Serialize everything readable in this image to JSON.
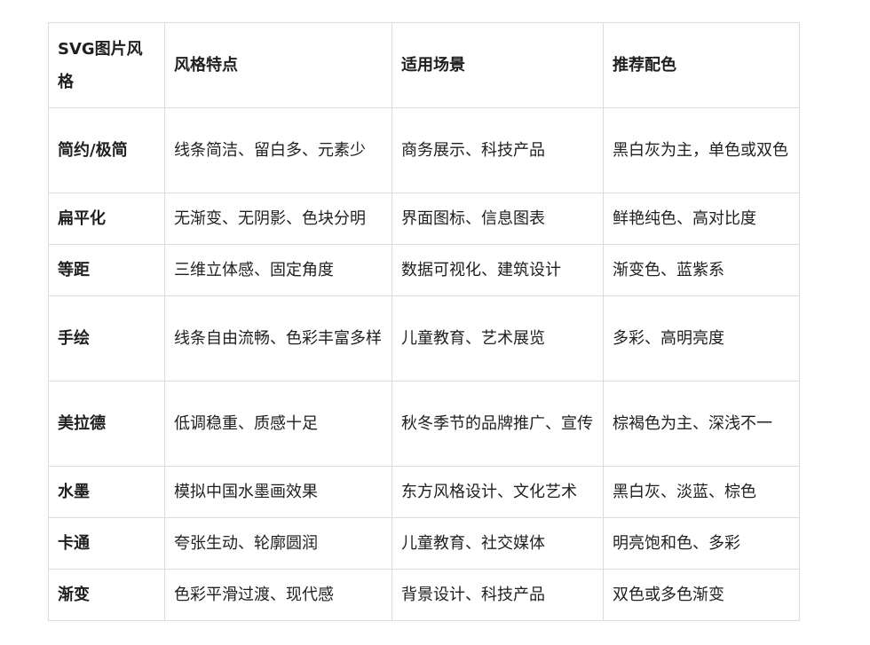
{
  "table": {
    "headers": [
      "SVG图片风格",
      "风格特点",
      "适用场景",
      "推荐配色"
    ],
    "rows": [
      [
        "简约/极简",
        "线条简洁、留白多、元素少",
        "商务展示、科技产品",
        "黑白灰为主，单色或双色"
      ],
      [
        "扁平化",
        "无渐变、无阴影、色块分明",
        "界面图标、信息图表",
        "鲜艳纯色、高对比度"
      ],
      [
        "等距",
        "三维立体感、固定角度",
        "数据可视化、建筑设计",
        "渐变色、蓝紫系"
      ],
      [
        "手绘",
        "线条自由流畅、色彩丰富多样",
        "儿童教育、艺术展览",
        "多彩、高明亮度"
      ],
      [
        "美拉德",
        "低调稳重、质感十足",
        "秋冬季节的品牌推广、宣传",
        "棕褐色为主、深浅不一"
      ],
      [
        "水墨",
        "模拟中国水墨画效果",
        "东方风格设计、文化艺术",
        "黑白灰、淡蓝、棕色"
      ],
      [
        "卡通",
        "夸张生动、轮廓圆润",
        "儿童教育、社交媒体",
        "明亮饱和色、多彩"
      ],
      [
        "渐变",
        "色彩平滑过渡、现代感",
        "背景设计、科技产品",
        "双色或多色渐变"
      ]
    ]
  }
}
